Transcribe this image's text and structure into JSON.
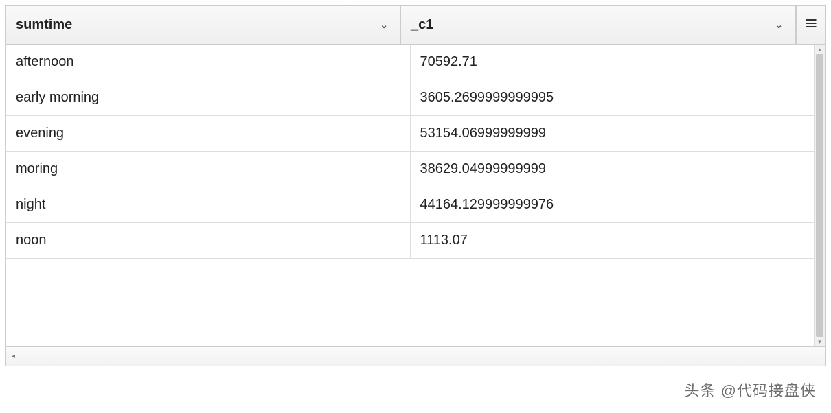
{
  "table": {
    "columns": [
      {
        "name": "sumtime"
      },
      {
        "name": "_c1"
      }
    ],
    "rows": [
      {
        "c0": "afternoon",
        "c1": "70592.71"
      },
      {
        "c0": "early morning",
        "c1": "3605.2699999999995"
      },
      {
        "c0": "evening",
        "c1": "53154.06999999999"
      },
      {
        "c0": "moring",
        "c1": "38629.04999999999"
      },
      {
        "c0": "night",
        "c1": "44164.129999999976"
      },
      {
        "c0": "noon",
        "c1": "1113.07"
      }
    ]
  },
  "icons": {
    "chevron_down": "⌄",
    "menu": "hamburger-icon",
    "scroll_up": "▴",
    "scroll_down": "▾",
    "footer_marker": "◂"
  },
  "watermark": "头条 @代码接盘侠"
}
